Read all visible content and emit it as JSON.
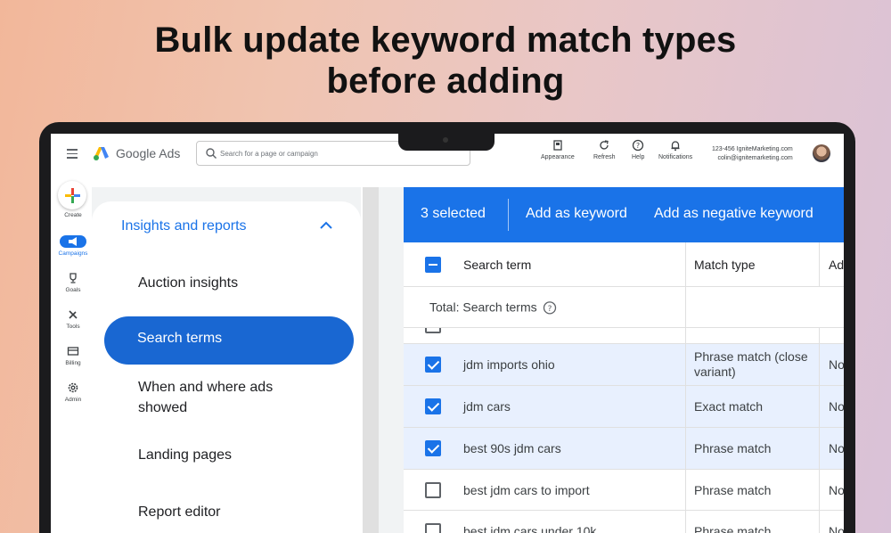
{
  "headline": {
    "line1": "Bulk update keyword match types",
    "line2": "before adding"
  },
  "topbar": {
    "app_name": "Google Ads",
    "search_placeholder": "Search for a page or campaign",
    "actions": [
      {
        "label": "Appearance",
        "icon": "appearance-icon"
      },
      {
        "label": "Refresh",
        "icon": "refresh-icon"
      },
      {
        "label": "Help",
        "icon": "help-icon"
      },
      {
        "label": "Notifications",
        "icon": "bell-icon"
      }
    ],
    "account_id": "123-456 IgniteMarketing.com",
    "account_email": "colin@ignitemarketing.com"
  },
  "rail": {
    "items": [
      {
        "label": "Create",
        "icon": "plus-icon"
      },
      {
        "label": "Campaigns",
        "icon": "megaphone-icon"
      },
      {
        "label": "Goals",
        "icon": "trophy-icon"
      },
      {
        "label": "Tools",
        "icon": "tools-icon"
      },
      {
        "label": "Billing",
        "icon": "card-icon"
      },
      {
        "label": "Admin",
        "icon": "gear-icon"
      }
    ]
  },
  "sidebar": {
    "section_title": "Insights and reports",
    "items": [
      {
        "label": "Auction insights"
      },
      {
        "label": "Search terms"
      },
      {
        "label": "When and where ads showed"
      },
      {
        "label": "Landing pages"
      },
      {
        "label": "Report editor"
      }
    ]
  },
  "selection_bar": {
    "count_label": "3 selected",
    "add_keyword": "Add as keyword",
    "add_negative": "Add as negative keyword"
  },
  "table": {
    "headers": [
      "Search term",
      "Match type",
      "Ad"
    ],
    "total_label": "Total: Search terms",
    "rows": [
      {
        "term": "jdm imports ohio",
        "match": "Phrase match (close variant)",
        "added": "No",
        "checked": true
      },
      {
        "term": "jdm cars",
        "match": "Exact match",
        "added": "No",
        "checked": true
      },
      {
        "term": "best 90s jdm cars",
        "match": "Phrase match",
        "added": "No",
        "checked": true
      },
      {
        "term": "best jdm cars to import",
        "match": "Phrase match",
        "added": "No",
        "checked": false
      },
      {
        "term": "best jdm cars under 10k",
        "match": "Phrase match",
        "added": "No",
        "checked": false
      }
    ]
  },
  "colors": {
    "accent": "#1a73e8",
    "selected_row": "#e8f0fe"
  }
}
